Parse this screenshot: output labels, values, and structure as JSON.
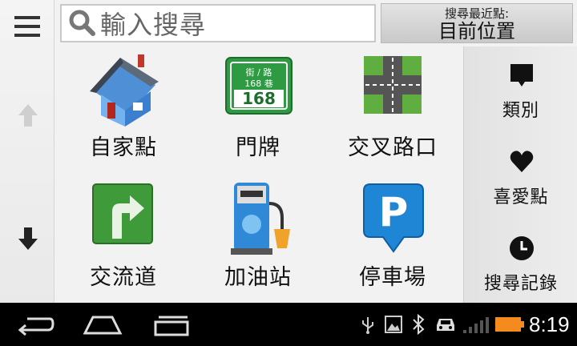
{
  "search": {
    "placeholder": "輸入搜尋"
  },
  "location": {
    "caption": "搜尋最近點:",
    "value": "目前位置"
  },
  "categories": [
    {
      "label": "自家點",
      "icon": "home-icon"
    },
    {
      "label": "門牌",
      "icon": "street-sign-icon",
      "sign_top": "街 / 路",
      "sign_mid": "168 巷",
      "sign_num": "168"
    },
    {
      "label": "交叉路口",
      "icon": "intersection-icon"
    },
    {
      "label": "交流道",
      "icon": "freeway-exit-icon"
    },
    {
      "label": "加油站",
      "icon": "gas-pump-icon"
    },
    {
      "label": "停車場",
      "icon": "parking-icon",
      "letter": "P"
    }
  ],
  "sidebar": [
    {
      "label": "類別",
      "icon": "category-icon"
    },
    {
      "label": "喜愛點",
      "icon": "heart-icon"
    },
    {
      "label": "搜尋記錄",
      "icon": "clock-icon"
    }
  ],
  "status_bar": {
    "time": "8:19"
  },
  "colors": {
    "battery": "#f58a1f",
    "accent_green": "#2e9a42",
    "parking_blue": "#1f86d6"
  }
}
